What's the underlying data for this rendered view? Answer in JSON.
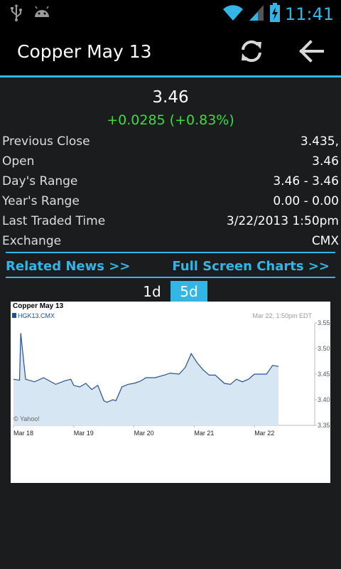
{
  "status_bar": {
    "time": "11:41",
    "icons": [
      "usb-icon",
      "android-icon",
      "wifi-icon",
      "signal-icon",
      "battery-charging-icon"
    ]
  },
  "action_bar": {
    "title": "Copper May 13",
    "refresh_icon": "refresh-icon",
    "back_icon": "back-arrow-icon"
  },
  "quote": {
    "price": "3.46",
    "change": "+0.0285 (+0.83%)",
    "change_color": "#3ddc3d"
  },
  "details": [
    {
      "label": "Previous Close",
      "value": "3.435,"
    },
    {
      "label": "Open",
      "value": "3.46"
    },
    {
      "label": "Day's Range",
      "value": "3.46 - 3.46"
    },
    {
      "label": "Year's Range",
      "value": "0.00 - 0.00"
    },
    {
      "label": "Last Traded Time",
      "value": "3/22/2013 1:50pm"
    },
    {
      "label": "Exchange",
      "value": "CMX"
    }
  ],
  "links": {
    "related_news": "Related News >>",
    "full_screen_charts": "Full Screen Charts >>"
  },
  "period_tabs": [
    {
      "label": "1d",
      "active": false
    },
    {
      "label": "5d",
      "active": true
    }
  ],
  "accent_color": "#33b5e5",
  "chart": {
    "title": "Copper May 13",
    "legend": "HGK13.CMX",
    "timestamp": "Mar 22, 1:50pm EDT",
    "credit": "© Yahoo!",
    "chart_data": {
      "type": "area",
      "title": "Copper May 13",
      "x_tick_labels": [
        "Mar 18",
        "Mar 19",
        "Mar 20",
        "Mar 21",
        "Mar 22"
      ],
      "y_tick_labels": [
        "3.55",
        "3.50",
        "3.45",
        "3.40",
        "3.35"
      ],
      "ylim": [
        3.35,
        3.55
      ],
      "legend": [
        "HGK13.CMX"
      ],
      "grid": false,
      "series": [
        {
          "name": "HGK13.CMX",
          "x": [
            0,
            0.1,
            0.12,
            0.2,
            0.35,
            0.5,
            0.7,
            0.85,
            0.95,
            1.0,
            1.1,
            1.2,
            1.3,
            1.4,
            1.5,
            1.55,
            1.65,
            1.7,
            1.8,
            1.9,
            2.0,
            2.1,
            2.2,
            2.35,
            2.5,
            2.6,
            2.75,
            2.85,
            2.95,
            3.05,
            3.15,
            3.25,
            3.35,
            3.5,
            3.6,
            3.7,
            3.8,
            3.9,
            4.0,
            4.1,
            4.2,
            4.3,
            4.4
          ],
          "values": [
            3.44,
            3.438,
            3.53,
            3.44,
            3.435,
            3.443,
            3.43,
            3.437,
            3.44,
            3.428,
            3.425,
            3.432,
            3.42,
            3.428,
            3.398,
            3.395,
            3.4,
            3.398,
            3.425,
            3.43,
            3.432,
            3.436,
            3.443,
            3.443,
            3.448,
            3.452,
            3.45,
            3.463,
            3.49,
            3.472,
            3.458,
            3.448,
            3.448,
            3.432,
            3.43,
            3.44,
            3.435,
            3.44,
            3.45,
            3.45,
            3.45,
            3.467,
            3.465
          ]
        }
      ]
    }
  }
}
